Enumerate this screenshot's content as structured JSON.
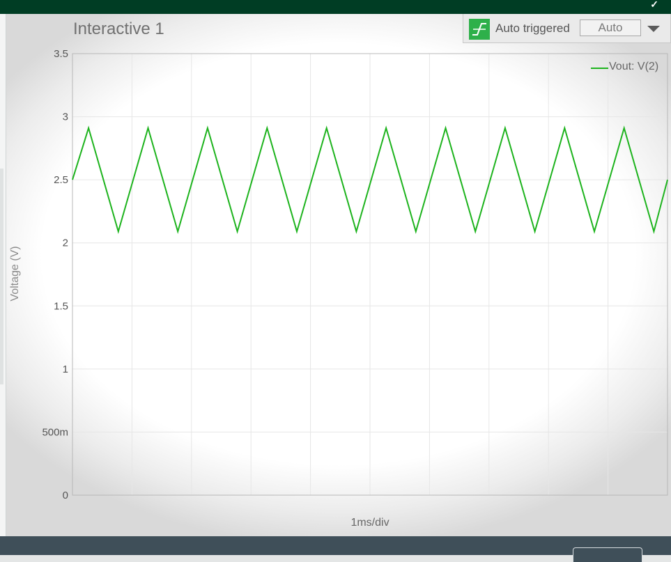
{
  "panel": {
    "title": "Interactive 1"
  },
  "trigger": {
    "label": "Auto triggered",
    "mode": "Auto",
    "icon": "trigger-edge-icon",
    "icon_color": "#2eb04a"
  },
  "chart_data": {
    "type": "line",
    "title": "",
    "xlabel": "1ms/div",
    "ylabel": "Voltage (V)",
    "ylim": [
      0,
      3.5
    ],
    "yticks": [
      {
        "value": 0,
        "label": "0"
      },
      {
        "value": 0.5,
        "label": "500m"
      },
      {
        "value": 1,
        "label": "1"
      },
      {
        "value": 1.5,
        "label": "1.5"
      },
      {
        "value": 2,
        "label": "2"
      },
      {
        "value": 2.5,
        "label": "2.5"
      },
      {
        "value": 3,
        "label": "3"
      },
      {
        "value": 3.5,
        "label": "3.5"
      }
    ],
    "x_divisions": 10,
    "grid": true,
    "legend": {
      "position": "top-right"
    },
    "series": [
      {
        "name": "Vout: V(2)",
        "color": "#1db31d",
        "x_div": [
          0,
          0.27,
          0.77,
          1.27,
          1.77,
          2.27,
          2.77,
          3.27,
          3.77,
          4.27,
          4.77,
          5.27,
          5.77,
          6.27,
          6.77,
          7.27,
          7.77,
          8.27,
          8.77,
          9.27,
          9.77,
          10
        ],
        "values": [
          2.5,
          2.91,
          2.09,
          2.91,
          2.09,
          2.91,
          2.09,
          2.91,
          2.09,
          2.91,
          2.09,
          2.91,
          2.09,
          2.91,
          2.09,
          2.91,
          2.09,
          2.91,
          2.09,
          2.91,
          2.09,
          2.5
        ]
      }
    ]
  }
}
